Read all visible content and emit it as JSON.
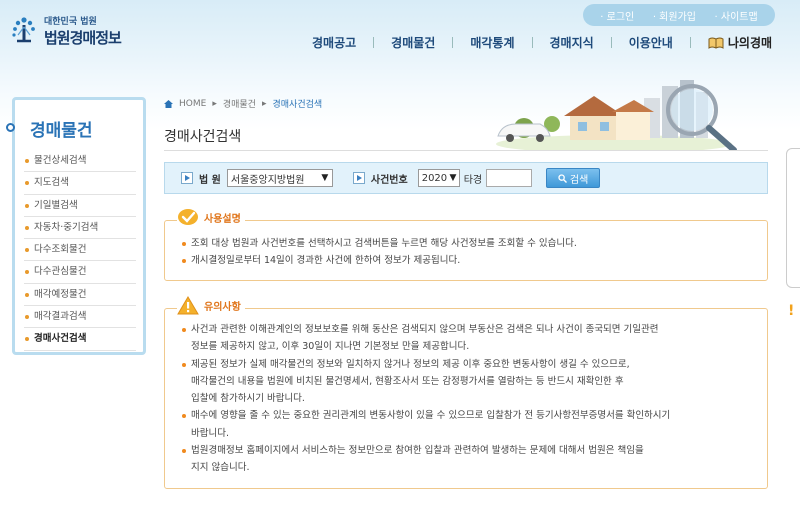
{
  "header": {
    "logo_sub": "대한민국 법원",
    "logo_main": "법원경매정보",
    "util_links": [
      "· 로그인",
      "· 회원가입",
      "· 사이트맵"
    ],
    "nav": [
      "경매공고",
      "경매물건",
      "매각통계",
      "경매지식",
      "이용안내",
      "나의경매"
    ]
  },
  "sidebar": {
    "title": "경매물건",
    "items": [
      "물건상세검색",
      "지도검색",
      "기일별검색",
      "자동차·중기검색",
      "다수조회물건",
      "다수관심물건",
      "매각예정물건",
      "매각결과검색",
      "경매사건검색"
    ],
    "active_index": 8
  },
  "breadcrumb": [
    "HOME",
    "경매물건",
    "경매사건검색"
  ],
  "page_title": "경매사건검색",
  "search": {
    "court_label": "법 원",
    "court_value": "서울중앙지방법원",
    "case_label": "사건번호",
    "year_value": "2020",
    "type_label": "타경",
    "case_input_value": "",
    "search_button": "검색"
  },
  "usage": {
    "title": "사용설명",
    "lines": [
      "조회 대상 법원과 사건번호를 선택하시고 검색버튼을 누르면 해당 사건정보를 조회할 수 있습니다.",
      "개시결정일로부터 14일이 경과한 사건에 한하여 정보가 제공됩니다."
    ]
  },
  "notice": {
    "title": "유의사항",
    "items": [
      [
        "사건과 관련한 이해관계인의 정보보호를 위해 동산은 검색되지 않으며 부동산은 검색은 되나 사건이 종국되면 기일관련",
        "정보를 제공하지 않고, 이후 30일이 지나면 기본정보 만을 제공합니다."
      ],
      [
        "제공된 정보가 실제 매각물건의 정보와 일치하지 않거나 정보의 제공 이후 중요한 변동사항이 생길 수 있으므로,",
        "매각물건의 내용을 법원에 비치된 물건명세서, 현황조사서 또는 감정평가서를 열람하는 등 반드시 재확인한 후",
        "입찰에 참가하시기 바랍니다."
      ],
      [
        "매수에 영향을 줄 수 있는 중요한 권리관계의 변동사항이 있을 수 있으므로 입찰참가 전 등기사항전부증명서를 확인하시기",
        "바랍니다."
      ],
      [
        "법원경매정보 홈페이지에서 서비스하는 정보만으로 참여한 입찰과 관련하여 발생하는 문제에 대해서 법원은 책임을",
        "지지 않습니다."
      ]
    ]
  }
}
